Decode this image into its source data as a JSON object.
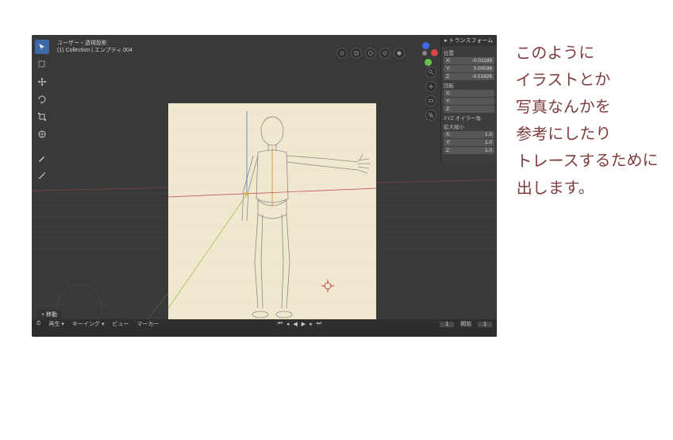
{
  "header": {
    "line1": "ユーザー・透視投影",
    "line2": "(1) Collection | エンプティ.004"
  },
  "n_panel": {
    "title": "▸ トランスフォーム",
    "location": {
      "label": "位置",
      "x_label": "X:",
      "x": "-0.01189",
      "y_label": "Y:",
      "y": "0.00036",
      "z_label": "Z:",
      "z": "-0.01826"
    },
    "rotation": {
      "label": "回転",
      "x_label": "X:",
      "y_label": "Y:",
      "z_label": "Z:"
    },
    "rotation_mode": "XYZ オイラー角",
    "scale": {
      "label": "拡大縮小",
      "x_label": "X:",
      "x": "1.0",
      "y_label": "Y:",
      "y": "1.0",
      "z_label": "Z:",
      "z": "1.0"
    }
  },
  "bottom_left_button": "+ 移動",
  "menu": {
    "item1": "再生 ▾",
    "item2": "キーイング ▾",
    "item3": "ビュー",
    "item4": "マーカー",
    "frame_label": "",
    "current_frame": "1",
    "start_label": "開始",
    "start": "1"
  },
  "handnote": "このように\nイラストとか\n写真なんかを\n参考にしたり\nトレースするために\n出します。",
  "colors": {
    "annotation": "#7f3d3d",
    "panel_bg": "#393939",
    "ref_paper": "#f1e9cf",
    "axis_x": "#d44747",
    "axis_y": "#6bc24a",
    "axis_z": "#3d6ae8"
  },
  "icons": {
    "cursor": "cursor",
    "select": "box-select",
    "move": "move",
    "rotate": "rotate",
    "scale": "scale",
    "transform": "transform",
    "annotate": "annotate",
    "measure": "measure"
  }
}
